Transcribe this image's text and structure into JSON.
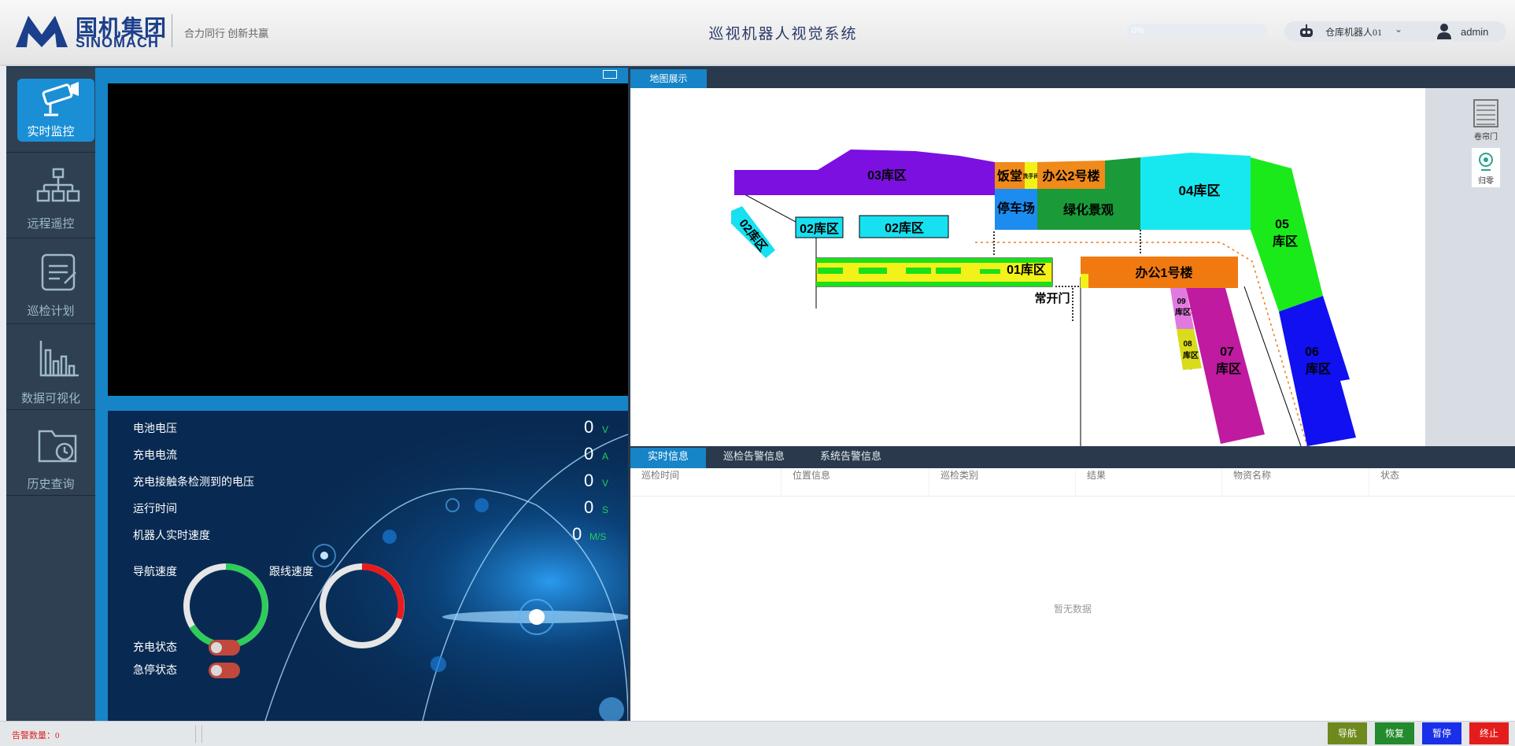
{
  "header": {
    "logo_cn": "国机集团",
    "logo_en": "SINOMACH",
    "slogan": "合力同行 创新共赢",
    "title": "巡视机器人视觉系统",
    "search_text": "0%",
    "robot_name": "仓库机器人01",
    "user_name": "admin"
  },
  "sidebar": {
    "items": [
      {
        "label": "实时监控",
        "icon": "surveillance-camera-icon",
        "active": true
      },
      {
        "label": "远程遥控",
        "icon": "hierarchy-icon"
      },
      {
        "label": "巡检计划",
        "icon": "clipboard-icon"
      },
      {
        "label": "数据可视化",
        "icon": "bar-chart-icon"
      },
      {
        "label": "历史查询",
        "icon": "folder-clock-icon"
      }
    ]
  },
  "telemetry": {
    "rows": [
      {
        "label": "电池电压",
        "value": "0",
        "unit": "V"
      },
      {
        "label": "充电电流",
        "value": "0",
        "unit": "A"
      },
      {
        "label": "充电接触条检测到的电压",
        "value": "0",
        "unit": "V"
      },
      {
        "label": "运行时间",
        "value": "0",
        "unit": "S"
      },
      {
        "label": "机器人实时速度",
        "value": "0",
        "unit": "M/S"
      }
    ],
    "nav_speed_label": "导航速度",
    "follow_speed_label": "跟线速度",
    "charge_state_label": "充电状态",
    "estop_state_label": "急停状态"
  },
  "map": {
    "tab": "地图展示",
    "labels": {
      "z03": "03库区",
      "z02a": "02库区",
      "z02b": "02库区",
      "z02c": "02库区",
      "canteen": "饭堂",
      "wash": "洗手间",
      "office2": "办公2号楼",
      "parking": "停车场",
      "green": "绿化景观",
      "z04": "04库区",
      "z05a": "05",
      "z05b": "库区",
      "z01": "01库区",
      "door": "常开门",
      "office1": "办公1号楼",
      "z09a": "09",
      "z09b": "库区",
      "z08a": "08",
      "z08b": "库区",
      "z07a": "07",
      "z07b": "库区",
      "z06a": "06",
      "z06b": "库区"
    },
    "tools": [
      {
        "label": "卷帘门",
        "icon": "rolling-shutter-icon"
      },
      {
        "label": "归零",
        "icon": "webcam-icon"
      }
    ]
  },
  "info": {
    "tabs": [
      "实时信息",
      "巡检告警信息",
      "系统告警信息"
    ],
    "columns": [
      "巡检时间",
      "位置信息",
      "巡检类别",
      "结果",
      "物资名称",
      "状态"
    ],
    "empty_text": "暂无数据"
  },
  "status": {
    "alarm_count": "告警数量：0"
  },
  "controls": [
    {
      "label": "导航",
      "color": "#6e8a1e"
    },
    {
      "label": "恢复",
      "color": "#238a2e"
    },
    {
      "label": "暂停",
      "color": "#1a2fe8"
    },
    {
      "label": "终止",
      "color": "#e51c1c"
    }
  ],
  "colors": {
    "accent": "#1684c7",
    "sidebar": "#2e4052",
    "unit_green": "#1fd05b"
  }
}
